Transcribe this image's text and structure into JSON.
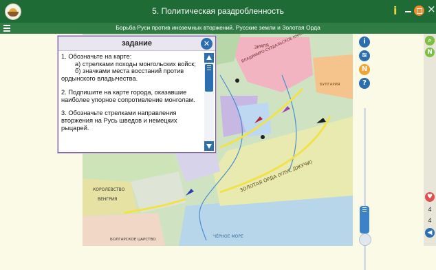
{
  "app": {
    "title": "5. Политическая раздробленность",
    "subtitle": "Борьба Руси против иноземных вторжений. Русские земли и Золотая Орда"
  },
  "icons": {
    "menu": "hamburger-icon",
    "info": "info-icon",
    "minimize": "minimize-icon",
    "restore": "restore-icon",
    "close": "close-icon"
  },
  "task": {
    "header": "задание",
    "paragraphs": [
      "1. Обозначьте на карте:",
      "а) стрелками походы монгольских войск;",
      "б) значками места восстаний против ордынского владычества.",
      "2. Подпишите на карте города, оказавшие наиболее упорное сопротивление монголам.",
      "3. Обозначьте стрелками направления вторжения на Русь шведов и немецких рыцарей."
    ]
  },
  "map": {
    "labels": {
      "zemlya": "ЗЕМЛЯ",
      "vladimir": "ВЛАДИМИРО-СУЗДАЛЬСКОЕ КНЯЖЕСТВО",
      "volga_bulgaria": "БУЛГАРИЯ",
      "zolotaya_orda": "ЗОЛОТАЯ ОРДА (УЛУС ДЖУЧИ)",
      "korolevstvo": "КОРОЛЕВСТВО",
      "vengriya": "ВЕНГРИЯ",
      "bolgarskoe": "БОЛГАРСКОЕ ЦАРСТВО",
      "chernoe_more": "ЧЁРНОЕ МОРЕ"
    }
  },
  "tools": {
    "info": "i",
    "layers": "layers-icon",
    "letter": "N",
    "help": "?"
  },
  "rightbar": {
    "page_current": "4",
    "page_total": "4"
  },
  "colors": {
    "topbar": "#1e6b35",
    "subbar": "#2f7d45",
    "accent_blue": "#2b6fb0",
    "panel_border": "#7a5aa0"
  }
}
